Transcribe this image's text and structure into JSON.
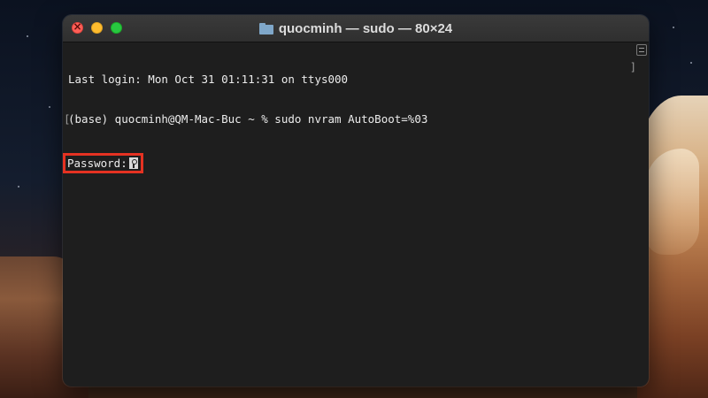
{
  "window": {
    "title": "quocminh — sudo — 80×24",
    "title_icon": "folder-icon"
  },
  "terminal": {
    "lines": [
      "Last login: Mon Oct 31 01:11:31 on ttys000",
      "(base) quocminh@QM-Mac-Buc ~ % sudo nvram AutoBoot=%03"
    ],
    "password_prompt": "Password:",
    "cursor_icon": "key-icon"
  },
  "colors": {
    "highlight": "#e53222",
    "terminal_bg": "#1e1e1e",
    "close": "#ff5f57",
    "minimize": "#febc2e",
    "maximize": "#28c840"
  }
}
